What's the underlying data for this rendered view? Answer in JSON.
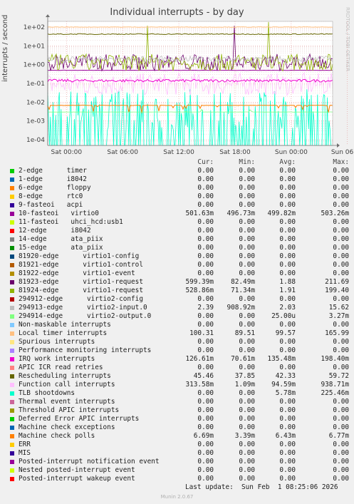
{
  "title": "Individual interrupts - by day",
  "side_label": "RRDTOOL / TOBI OETIKER",
  "footer": "Munin 2.0.67",
  "last_update": "Last update:  Sun Feb  1 08:25:06 2026",
  "colors": {
    "background": "#f0f0f0",
    "plot_bg": "#ffffff",
    "grid_major": "#e08080",
    "grid_minor": "#e0c0c0"
  },
  "chart_data": {
    "type": "line",
    "ylabel": "interrupts / second",
    "y_scale": "log",
    "ylim": [
      5e-05,
      200
    ],
    "y_ticks": [
      "1e+02",
      "1e+01",
      "1e+00",
      "1e-01",
      "1e-02",
      "1e-03",
      "1e-04"
    ],
    "x_ticks": [
      "Sat 00:00",
      "Sat 06:00",
      "Sat 12:00",
      "Sat 18:00",
      "Sun 00:00",
      "Sun 06:00"
    ],
    "grid": true,
    "headers": [
      "Cur:",
      "Min:",
      "Avg:",
      "Max:"
    ],
    "series": [
      {
        "name": "2-edge      timer",
        "color": "#00cc00",
        "cur": "0.00",
        "min": "0.00",
        "avg": "0.00",
        "max": "0.00"
      },
      {
        "name": "1-edge      i8042",
        "color": "#0066b3",
        "cur": "0.00",
        "min": "0.00",
        "avg": "0.00",
        "max": "0.00"
      },
      {
        "name": "6-edge      floppy",
        "color": "#ff8000",
        "cur": "0.00",
        "min": "0.00",
        "avg": "0.00",
        "max": "0.00"
      },
      {
        "name": "8-edge      rtc0",
        "color": "#ffcc00",
        "cur": "0.00",
        "min": "0.00",
        "avg": "0.00",
        "max": "0.00"
      },
      {
        "name": "9-fasteoi   acpi",
        "color": "#330099",
        "cur": "0.00",
        "min": "0.00",
        "avg": "0.00",
        "max": "0.00"
      },
      {
        "name": "10-fasteoi   virtio0",
        "color": "#990099",
        "cur": "501.63m",
        "min": "496.73m",
        "avg": "499.82m",
        "max": "503.26m"
      },
      {
        "name": "11-fasteoi   uhci_hcd:usb1",
        "color": "#ccff00",
        "cur": "0.00",
        "min": "0.00",
        "avg": "0.00",
        "max": "0.00"
      },
      {
        "name": "12-edge      i8042",
        "color": "#ff0000",
        "cur": "0.00",
        "min": "0.00",
        "avg": "0.00",
        "max": "0.00"
      },
      {
        "name": "14-edge      ata_piix",
        "color": "#808080",
        "cur": "0.00",
        "min": "0.00",
        "avg": "0.00",
        "max": "0.00"
      },
      {
        "name": "15-edge      ata_piix",
        "color": "#008f00",
        "cur": "0.00",
        "min": "0.00",
        "avg": "0.00",
        "max": "0.00"
      },
      {
        "name": "81920-edge      virtio1-config",
        "color": "#00487d",
        "cur": "0.00",
        "min": "0.00",
        "avg": "0.00",
        "max": "0.00"
      },
      {
        "name": "81921-edge      virtio1-control",
        "color": "#b35a00",
        "cur": "0.00",
        "min": "0.00",
        "avg": "0.00",
        "max": "0.00"
      },
      {
        "name": "81922-edge      virtio1-event",
        "color": "#b38f00",
        "cur": "0.00",
        "min": "0.00",
        "avg": "0.00",
        "max": "0.00"
      },
      {
        "name": "81923-edge      virtio1-request",
        "color": "#6b006b",
        "cur": "599.39m",
        "min": "82.49m",
        "avg": "1.88",
        "max": "211.69"
      },
      {
        "name": "81924-edge      virtio1-request",
        "color": "#8fb300",
        "cur": "528.86m",
        "min": "71.34m",
        "avg": "1.91",
        "max": "199.40"
      },
      {
        "name": "294912-edge      virtio2-config",
        "color": "#b30000",
        "cur": "0.00",
        "min": "0.00",
        "avg": "0.00",
        "max": "0.00"
      },
      {
        "name": "294913-edge      virtio2-input.0",
        "color": "#bebebe",
        "cur": "2.39",
        "min": "908.92m",
        "avg": "2.03",
        "max": "15.62"
      },
      {
        "name": "294914-edge      virtio2-output.0",
        "color": "#80ff80",
        "cur": "0.00",
        "min": "0.00",
        "avg": "25.00u",
        "max": "3.27m"
      },
      {
        "name": "Non-maskable interrupts",
        "color": "#80c9ff",
        "cur": "0.00",
        "min": "0.00",
        "avg": "0.00",
        "max": "0.00"
      },
      {
        "name": "Local timer interrupts",
        "color": "#ffc080",
        "cur": "100.31",
        "min": "89.51",
        "avg": "99.57",
        "max": "165.99"
      },
      {
        "name": "Spurious interrupts",
        "color": "#ffe680",
        "cur": "0.00",
        "min": "0.00",
        "avg": "0.00",
        "max": "0.00"
      },
      {
        "name": "Performance monitoring interrupts",
        "color": "#aa80ff",
        "cur": "0.00",
        "min": "0.00",
        "avg": "0.00",
        "max": "0.00"
      },
      {
        "name": "IRQ work interrupts",
        "color": "#ee00cc",
        "cur": "126.61m",
        "min": "70.61m",
        "avg": "135.48m",
        "max": "198.40m"
      },
      {
        "name": "APIC ICR read retries",
        "color": "#ff8080",
        "cur": "0.00",
        "min": "0.00",
        "avg": "0.00",
        "max": "0.00"
      },
      {
        "name": "Rescheduling interrupts",
        "color": "#666600",
        "cur": "45.46",
        "min": "37.85",
        "avg": "42.33",
        "max": "59.72"
      },
      {
        "name": "Function call interrupts",
        "color": "#ffbfff",
        "cur": "313.58m",
        "min": "1.09m",
        "avg": "94.59m",
        "max": "938.71m"
      },
      {
        "name": "TLB shootdowns",
        "color": "#00ffcc",
        "cur": "0.00",
        "min": "0.00",
        "avg": "5.78m",
        "max": "225.46m"
      },
      {
        "name": "Thermal event interrupts",
        "color": "#cc6699",
        "cur": "0.00",
        "min": "0.00",
        "avg": "0.00",
        "max": "0.00"
      },
      {
        "name": "Threshold APIC interrupts",
        "color": "#999900",
        "cur": "0.00",
        "min": "0.00",
        "avg": "0.00",
        "max": "0.00"
      },
      {
        "name": "Deferred Error APIC interrupts",
        "color": "#00cc00",
        "cur": "0.00",
        "min": "0.00",
        "avg": "0.00",
        "max": "0.00"
      },
      {
        "name": "Machine check exceptions",
        "color": "#0066b3",
        "cur": "0.00",
        "min": "0.00",
        "avg": "0.00",
        "max": "0.00"
      },
      {
        "name": "Machine check polls",
        "color": "#ff8000",
        "cur": "6.69m",
        "min": "3.39m",
        "avg": "6.43m",
        "max": "6.77m"
      },
      {
        "name": "ERR",
        "color": "#ffcc00",
        "cur": "0.00",
        "min": "0.00",
        "avg": "0.00",
        "max": "0.00"
      },
      {
        "name": "MIS",
        "color": "#330099",
        "cur": "0.00",
        "min": "0.00",
        "avg": "0.00",
        "max": "0.00"
      },
      {
        "name": "Posted-interrupt notification event",
        "color": "#990099",
        "cur": "0.00",
        "min": "0.00",
        "avg": "0.00",
        "max": "0.00"
      },
      {
        "name": "Nested posted-interrupt event",
        "color": "#ccff00",
        "cur": "0.00",
        "min": "0.00",
        "avg": "0.00",
        "max": "0.00"
      },
      {
        "name": "Posted-interrupt wakeup event",
        "color": "#ff0000",
        "cur": "0.00",
        "min": "0.00",
        "avg": "0.00",
        "max": "0.00"
      }
    ]
  }
}
